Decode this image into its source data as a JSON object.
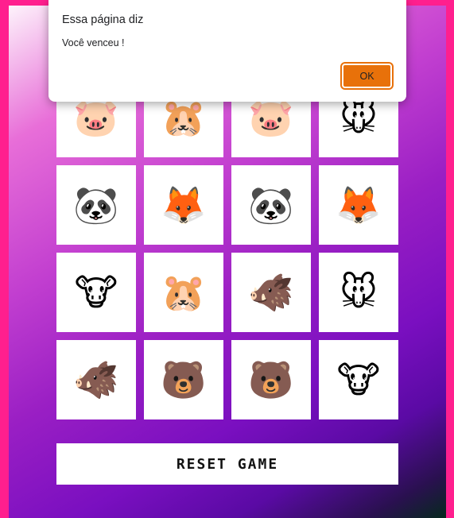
{
  "dialog": {
    "title": "Essa página diz",
    "message": "Você venceu !",
    "ok_label": "OK"
  },
  "board": {
    "cards": [
      {
        "animal": "pig",
        "glyph": "🐷"
      },
      {
        "animal": "hamster",
        "glyph": "🐹"
      },
      {
        "animal": "pig",
        "glyph": "🐷"
      },
      {
        "animal": "mouse",
        "glyph": "🐭"
      },
      {
        "animal": "panda",
        "glyph": "🐼"
      },
      {
        "animal": "fox",
        "glyph": "🦊"
      },
      {
        "animal": "panda",
        "glyph": "🐼"
      },
      {
        "animal": "fox",
        "glyph": "🦊"
      },
      {
        "animal": "cow",
        "glyph": "🐮"
      },
      {
        "animal": "hamster",
        "glyph": "🐹"
      },
      {
        "animal": "boar",
        "glyph": "🐗"
      },
      {
        "animal": "mouse",
        "glyph": "🐭"
      },
      {
        "animal": "boar",
        "glyph": "🐗"
      },
      {
        "animal": "bear",
        "glyph": "🐻"
      },
      {
        "animal": "bear",
        "glyph": "🐻"
      },
      {
        "animal": "cow",
        "glyph": "🐮"
      }
    ]
  },
  "reset": {
    "label": "RESET GAME"
  },
  "colors": {
    "page_border": "#ff1f8e",
    "ok_button": "#e8710a",
    "card_background": "#ffffff"
  }
}
